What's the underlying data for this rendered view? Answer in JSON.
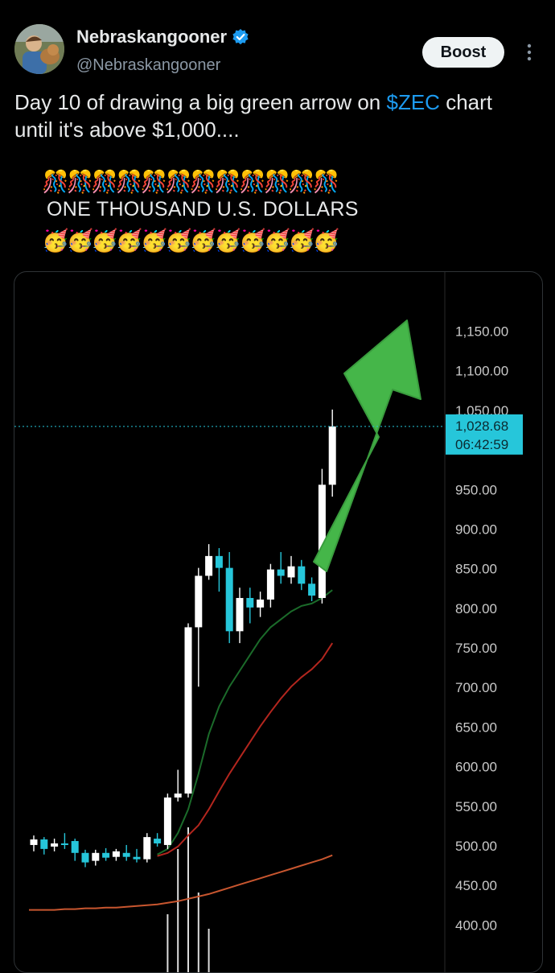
{
  "author": {
    "display_name": "Nebraskangooner",
    "handle": "@Nebraskangooner",
    "verified_icon": "verified-badge-icon"
  },
  "actions": {
    "boost_label": "Boost",
    "more_icon": "more-vertical-icon"
  },
  "tweet": {
    "text_part1": "Day 10 of drawing a big green arrow on ",
    "cashtag": "$ZEC",
    "text_part2": " chart",
    "text_line2": "until it's above $1,000....",
    "emoji_line1": "🎊🎊🎊🎊🎊🎊🎊🎊🎊🎊🎊🎊",
    "big_line": "ONE THOUSAND U.S. DOLLARS",
    "emoji_line2": "🥳🥳🥳🥳🥳🥳🥳🥳🥳🥳🥳🥳"
  },
  "colors": {
    "accent": "#1d9bf0",
    "candle_up": "#ffffff",
    "candle_down": "#26c6da",
    "arrow": "#45b649",
    "ma_fast": "#1b6b2a",
    "ma_mid": "#b3261e",
    "ma_slow": "#c8562f",
    "price_label_bg": "#26c6da"
  },
  "chart_data": {
    "type": "candlestick",
    "ylim": [
      380,
      1180
    ],
    "y_ticks": [
      "1,150.00",
      "1,100.00",
      "1,050.00",
      "950.00",
      "900.00",
      "850.00",
      "800.00",
      "750.00",
      "700.00",
      "650.00",
      "600.00",
      "550.00",
      "500.00",
      "450.00",
      "400.00"
    ],
    "y_tick_values": [
      1150,
      1100,
      1050,
      950,
      900,
      850,
      800,
      750,
      700,
      650,
      600,
      550,
      500,
      450,
      400
    ],
    "last_price": "1,028.68",
    "last_price_value": 1028.68,
    "countdown": "06:42:59",
    "candles": [
      {
        "o": 500,
        "c": 507,
        "h": 512,
        "l": 492
      },
      {
        "o": 507,
        "c": 495,
        "h": 510,
        "l": 488
      },
      {
        "o": 498,
        "c": 502,
        "h": 508,
        "l": 492
      },
      {
        "o": 502,
        "c": 500,
        "h": 515,
        "l": 495
      },
      {
        "o": 505,
        "c": 490,
        "h": 508,
        "l": 480
      },
      {
        "o": 490,
        "c": 478,
        "h": 494,
        "l": 472
      },
      {
        "o": 480,
        "c": 490,
        "h": 494,
        "l": 474
      },
      {
        "o": 490,
        "c": 484,
        "h": 496,
        "l": 480
      },
      {
        "o": 485,
        "c": 492,
        "h": 495,
        "l": 480
      },
      {
        "o": 490,
        "c": 485,
        "h": 500,
        "l": 480
      },
      {
        "o": 485,
        "c": 482,
        "h": 495,
        "l": 478
      },
      {
        "o": 482,
        "c": 510,
        "h": 515,
        "l": 478
      },
      {
        "o": 508,
        "c": 502,
        "h": 515,
        "l": 498
      },
      {
        "o": 500,
        "c": 560,
        "h": 565,
        "l": 495
      },
      {
        "o": 560,
        "c": 565,
        "h": 595,
        "l": 555
      },
      {
        "o": 565,
        "c": 775,
        "h": 780,
        "l": 560
      },
      {
        "o": 775,
        "c": 840,
        "h": 850,
        "l": 700
      },
      {
        "o": 840,
        "c": 865,
        "h": 880,
        "l": 835
      },
      {
        "o": 865,
        "c": 850,
        "h": 875,
        "l": 820
      },
      {
        "o": 850,
        "c": 770,
        "h": 870,
        "l": 755
      },
      {
        "o": 770,
        "c": 812,
        "h": 825,
        "l": 755
      },
      {
        "o": 812,
        "c": 800,
        "h": 825,
        "l": 780
      },
      {
        "o": 800,
        "c": 810,
        "h": 820,
        "l": 788
      },
      {
        "o": 810,
        "c": 848,
        "h": 855,
        "l": 800
      },
      {
        "o": 848,
        "c": 840,
        "h": 870,
        "l": 830
      },
      {
        "o": 838,
        "c": 852,
        "h": 865,
        "l": 830
      },
      {
        "o": 852,
        "c": 830,
        "h": 860,
        "l": 822
      },
      {
        "o": 830,
        "c": 815,
        "h": 838,
        "l": 808
      },
      {
        "o": 812,
        "c": 955,
        "h": 975,
        "l": 805
      },
      {
        "o": 955,
        "c": 1028.68,
        "h": 1050,
        "l": 940
      }
    ],
    "ma_fast": [
      null,
      null,
      null,
      null,
      null,
      null,
      null,
      null,
      null,
      null,
      null,
      null,
      488,
      495,
      515,
      545,
      590,
      640,
      675,
      700,
      720,
      740,
      760,
      775,
      785,
      795,
      802,
      805,
      812,
      822
    ],
    "ma_mid": [
      null,
      null,
      null,
      null,
      null,
      null,
      null,
      null,
      null,
      null,
      null,
      null,
      486,
      490,
      498,
      512,
      525,
      545,
      568,
      590,
      610,
      630,
      650,
      668,
      685,
      700,
      712,
      722,
      735,
      755
    ],
    "ma_slow": [
      418,
      418,
      418,
      419,
      419,
      420,
      420,
      421,
      421,
      422,
      423,
      424,
      425,
      427,
      429,
      432,
      435,
      438,
      442,
      446,
      450,
      454,
      458,
      462,
      466,
      470,
      474,
      478,
      482,
      487
    ],
    "volume_spikes": [
      {
        "i": 14,
        "h": 0.85
      },
      {
        "i": 15,
        "h": 1.0
      },
      {
        "i": 16,
        "h": 0.55
      },
      {
        "i": 13,
        "h": 0.4
      },
      {
        "i": 17,
        "h": 0.3
      }
    ]
  }
}
